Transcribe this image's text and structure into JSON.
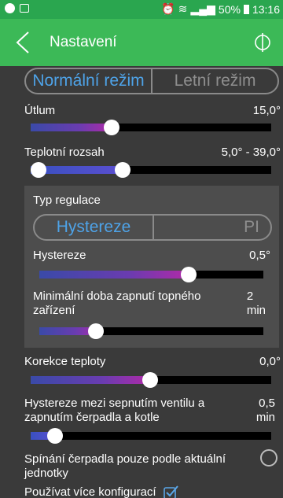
{
  "statusbar": {
    "battery": "50%",
    "time": "13:16"
  },
  "appbar": {
    "title": "Nastavení"
  },
  "mode_toggle": {
    "active": "Normální režim",
    "inactive": "Letní režim"
  },
  "utlum": {
    "label": "Útlum",
    "value": "15,0°",
    "level": 0.4
  },
  "teplotni_rozsah": {
    "label": "Teplotní rozsah",
    "value": "5,0° -  39,0°",
    "low": 0.05,
    "high": 0.39
  },
  "typ_regulace": {
    "label": "Typ regulace",
    "active": "Hystereze",
    "inactive": "PI",
    "hystereze": {
      "label": "Hystereze",
      "value": "0,5°",
      "level": 0.67
    },
    "min_doba": {
      "label_line1": "Minimální doba zapnutí topného",
      "label_line2": "zařízení",
      "value_line1": "2",
      "value_line2": "min",
      "level": 0.27
    }
  },
  "korekce": {
    "label": "Korekce teploty",
    "value": "0,0°",
    "level": 0.5
  },
  "hystereze_sepnuti": {
    "label_line1": "Hystereze mezi sepnutím ventilu a",
    "label_line2": "zapnutím čerpadla a kotle",
    "value_line1": "0,5",
    "value_line2": "min",
    "level": 0.1
  },
  "spinani": {
    "label_line1": "Spínání čerpadla pouze podle aktuální",
    "label_line2": "jednotky"
  },
  "pouzivat": {
    "label": "Používat více konfigurací"
  }
}
